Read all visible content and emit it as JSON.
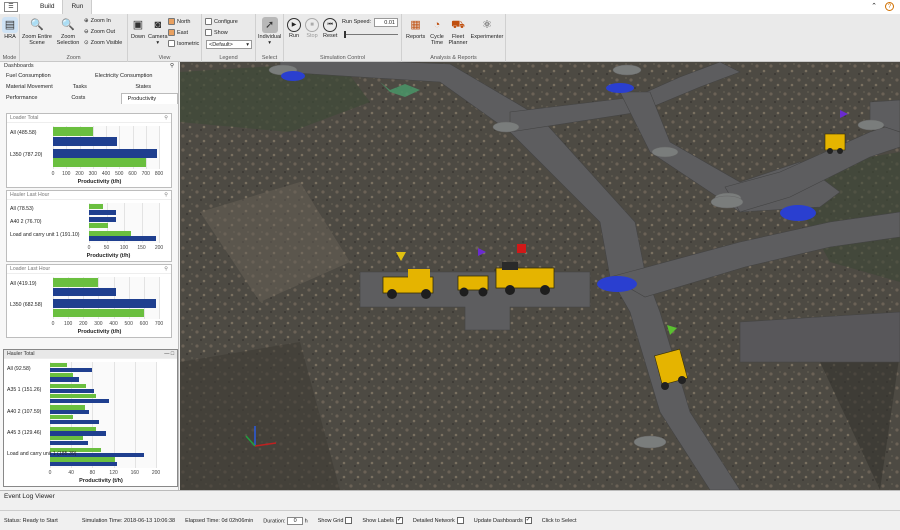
{
  "titlebar": {
    "menu_glyph": "☰",
    "tabs": [
      "Build",
      "Run"
    ],
    "help": "?",
    "minimize": "⌃"
  },
  "ribbon": {
    "groups": [
      "Mode",
      "Zoom",
      "View",
      "Legend",
      "Select",
      "Simulation Control",
      "Analysis & Reports"
    ],
    "hra": "HRA",
    "zoom_entire": "Zoom Entire Scene",
    "zoom_selection": "Zoom Selection",
    "zoom_in": "Zoom In",
    "zoom_out": "Zoom Out",
    "zoom_visible": "Zoom Visible",
    "down": "Down",
    "camera": "Camera",
    "north": "North",
    "east": "East",
    "isometric": "Isometric",
    "configure": "Configure",
    "show": "Show",
    "legend_default": "<Default>",
    "individual": "Individual",
    "run": "Run",
    "stop": "Stop",
    "reset": "Reset",
    "run_speed_label": "Run Speed:",
    "run_speed": "0.01",
    "reports": "Reports",
    "cycle_time": "Cycle Time",
    "fleet_planner": "Fleet Planner",
    "experimenter": "Experimenter"
  },
  "dashboards": {
    "title": "Dashboards",
    "pin": "⚲",
    "tabs_row1": [
      "Fuel Consumption",
      "Electricity Consumption"
    ],
    "tabs_row2": [
      "Material Movement",
      "Tasks",
      "States"
    ],
    "tabs_row3": [
      "Performance",
      "Costs",
      "Productivity"
    ],
    "axis_title": "Productivity (t/h)"
  },
  "colors": {
    "green": "#6abf3f",
    "blue": "#1f3f8f"
  },
  "chart_data": [
    {
      "type": "bar",
      "title": "Loader Total",
      "xlabel": "Productivity (t/h)",
      "xlim": [
        0,
        800
      ],
      "xticks": [
        "0",
        "100",
        "200",
        "300",
        "400",
        "500",
        "600",
        "700",
        "800"
      ],
      "rows": [
        {
          "label": "All (485.58)",
          "series": [
            {
              "color": "green",
              "value": 300
            },
            {
              "color": "blue",
              "value": 485.58
            }
          ]
        },
        {
          "label": "L350 (787.20)",
          "series": [
            {
              "color": "blue",
              "value": 787.2
            },
            {
              "color": "green",
              "value": 700
            }
          ]
        }
      ]
    },
    {
      "type": "bar",
      "title": "Hauler Last Hour",
      "xlabel": "Productivity (t/h)",
      "xlim": [
        0,
        200
      ],
      "xticks": [
        "0",
        "50",
        "100",
        "150",
        "200"
      ],
      "rows": [
        {
          "label": "All (78.53)",
          "series": [
            {
              "color": "green",
              "value": 40
            },
            {
              "color": "blue",
              "value": 78.53
            }
          ]
        },
        {
          "label": "A40 2 (76.70)",
          "series": [
            {
              "color": "blue",
              "value": 76.7
            },
            {
              "color": "green",
              "value": 55
            }
          ]
        },
        {
          "label": "Load and carry unit 1 (191.10)",
          "series": [
            {
              "color": "green",
              "value": 120
            },
            {
              "color": "blue",
              "value": 191.1
            }
          ]
        }
      ]
    },
    {
      "type": "bar",
      "title": "Loader Last Hour",
      "xlabel": "Productivity (t/h)",
      "xlim": [
        0,
        700
      ],
      "xticks": [
        "0",
        "100",
        "200",
        "300",
        "400",
        "500",
        "600",
        "700"
      ],
      "rows": [
        {
          "label": "All (419.19)",
          "series": [
            {
              "color": "green",
              "value": 300
            },
            {
              "color": "blue",
              "value": 419.19
            }
          ]
        },
        {
          "label": "L350 (682.58)",
          "series": [
            {
              "color": "blue",
              "value": 682.58
            },
            {
              "color": "green",
              "value": 600
            }
          ]
        }
      ]
    },
    {
      "type": "bar",
      "title": "Hauler Total",
      "xlabel": "Productivity (t/h)",
      "xlim": [
        0,
        200
      ],
      "xticks": [
        "0",
        "40",
        "80",
        "120",
        "160",
        "200"
      ],
      "rows": [
        {
          "label": "All (92.58)",
          "series": [
            {
              "color": "green",
              "value": 60
            },
            {
              "color": "blue",
              "value": 92.58
            }
          ]
        },
        {
          "label": "A35 1 (151.26)",
          "series": [
            {
              "color": "green",
              "value": 100
            },
            {
              "color": "blue",
              "value": 151.26
            }
          ]
        },
        {
          "label": "A40 2 (107.59)",
          "series": [
            {
              "color": "green",
              "value": 80
            },
            {
              "color": "blue",
              "value": 107.59
            }
          ]
        },
        {
          "label": "A45 3 (129.46)",
          "series": [
            {
              "color": "green",
              "value": 90
            },
            {
              "color": "blue",
              "value": 129.46
            }
          ]
        },
        {
          "label": "Load and carry unit 1 (185.39)",
          "series": [
            {
              "color": "green",
              "value": 150
            },
            {
              "color": "blue",
              "value": 185.39
            }
          ]
        }
      ]
    }
  ],
  "bottom": {
    "event_log": "Event Log Viewer"
  },
  "status": {
    "ready": "Status: Ready to Start",
    "sim_time": "Simulation Time: 2018-06-13 10:06:38",
    "elapsed": "Elapsed Time: 0d 02h06min",
    "duration_label": "Duration:",
    "duration_value": "0",
    "duration_unit": "h",
    "show_grid": "Show Grid",
    "show_labels": "Show Labels",
    "detailed_network": "Detailed Network",
    "update_dashboards": "Update Dashboards",
    "click_select": "Click to Select",
    "check": "✓"
  }
}
